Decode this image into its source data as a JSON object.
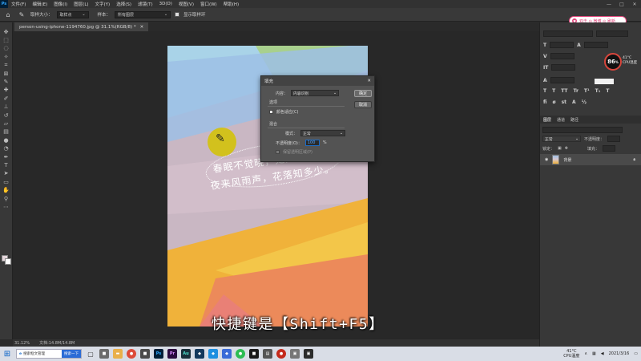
{
  "app": {
    "logo": "Ps",
    "menu": [
      "文件(F)",
      "编辑(E)",
      "图像(I)",
      "图层(L)",
      "文字(Y)",
      "选择(S)",
      "滤镜(T)",
      "3D(D)",
      "视图(V)",
      "窗口(W)",
      "帮助(H)"
    ],
    "window_controls": [
      "—",
      "□",
      "✕"
    ]
  },
  "options_bar": {
    "sample_size_label": "取样大小：",
    "sample_size_value": "取样点",
    "sample_label": "样本：",
    "sample_value": "所有图层",
    "show_ring_label": "显示取样环"
  },
  "badge": {
    "icon": "heart-icon",
    "text": "双击 ◎ 微博 ◎ 刷新"
  },
  "document": {
    "tab_title": "person-using-iphone-1194760.jpg @ 31.1%(RGB/8) *",
    "tab_close": "✕",
    "poem_line1": "春眠不觉晓，处处闻啼鸟。",
    "poem_line2": "夜来风雨声，花落知多少。"
  },
  "fill_dialog": {
    "title": "填充",
    "close": "✕",
    "contents_label": "内容：",
    "contents_value": "内容识别",
    "ok_label": "确定",
    "cancel_label": "取消",
    "options_label": "选项",
    "color_adapt_label": "颜色适应(C)",
    "blending_label": "混合",
    "mode_label": "模式：",
    "mode_value": "正常",
    "opacity_label": "不透明度(O)：",
    "opacity_value": "100",
    "opacity_unit": "%",
    "preserve_label": "保留透明区域(P)"
  },
  "subtitle": "快捷键是【Shift+F5】",
  "status_bar": {
    "zoom": "31.12%",
    "doc_info": "文档:14.8M/14.8M"
  },
  "right_panel": {
    "cpu_value": "86",
    "cpu_unit": "%",
    "temp_value": "41°C",
    "temp_label": "CPU温度",
    "layers_tabs": [
      "图层",
      "通道",
      "路径"
    ],
    "blend_mode": "正常",
    "opacity_label": "不透明度：",
    "lock_label": "锁定：",
    "fill_label": "填充：",
    "layer_name": "背景"
  },
  "taskbar": {
    "search_text": "搜索框文管理",
    "search_button": "搜索一下",
    "temp": "41°C",
    "cpu_label": "CPU温度",
    "clock_time": "",
    "clock_date": "2021/3/16"
  },
  "colors": {
    "accent": "#31a8ff",
    "badge_pink": "#e0457b",
    "canvas_blue": "#9dc0e5",
    "canvas_green": "#a8d08d",
    "canvas_yellow": "#f0b23a",
    "canvas_orange": "#ec8a5a",
    "marker_yellow": "#d4c300"
  }
}
